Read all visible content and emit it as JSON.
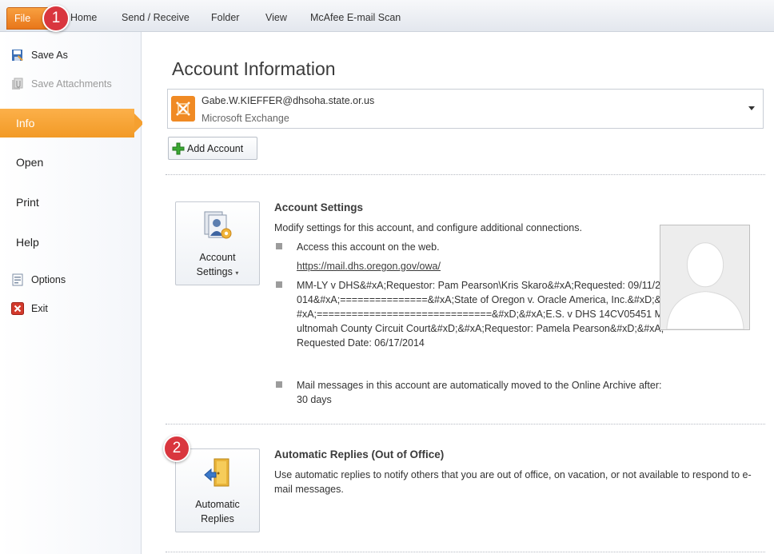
{
  "ribbon": {
    "tabs": {
      "file": "File",
      "home": "Home",
      "send_receive": "Send / Receive",
      "folder": "Folder",
      "view": "View",
      "mcafee": "McAfee E-mail Scan"
    }
  },
  "callouts": {
    "one": "1",
    "two": "2"
  },
  "sidebar": {
    "save_as": "Save As",
    "save_attachments": "Save Attachments",
    "info": "Info",
    "open": "Open",
    "print": "Print",
    "help": "Help",
    "options": "Options",
    "exit": "Exit"
  },
  "main": {
    "title": "Account Information",
    "account": {
      "email": "Gabe.W.KIEFFER@dhsoha.state.or.us",
      "type": "Microsoft Exchange"
    },
    "add_account": "Add Account",
    "account_settings": {
      "button_line1": "Account",
      "button_line2": "Settings",
      "title": "Account Settings",
      "description": "Modify settings for this account, and configure additional connections.",
      "bullet_web": "Access this account on the web.",
      "web_link": "https://mail.dhs.oregon.gov/owa/",
      "bullet_note": "MM-LY v DHS&#xA;Requestor: Pam Pearson\\Kris Skaro&#xA;Requested: 09/11/2014&#xA;===============&#xA;State of Oregon v. Oracle America, Inc.&#xD;&#xA;==============================&#xD;&#xA;E.S. v DHS 14CV05451 Multnomah County Circuit Court&#xD;&#xA;Requestor: Pamela Pearson&#xD;&#xA;Requested Date: 06/17/2014",
      "bullet_archive": "Mail messages in this account are automatically moved to the Online Archive after: 30 days"
    },
    "automatic_replies": {
      "button_line1": "Automatic",
      "button_line2": "Replies",
      "title": "Automatic Replies (Out of Office)",
      "description": "Use automatic replies to notify others that you are out of office, on vacation, or not available to respond to e-mail messages."
    }
  },
  "colors": {
    "file_tab": "#e8761a",
    "info_selected": "#f5a030",
    "callout": "#d9363e"
  }
}
